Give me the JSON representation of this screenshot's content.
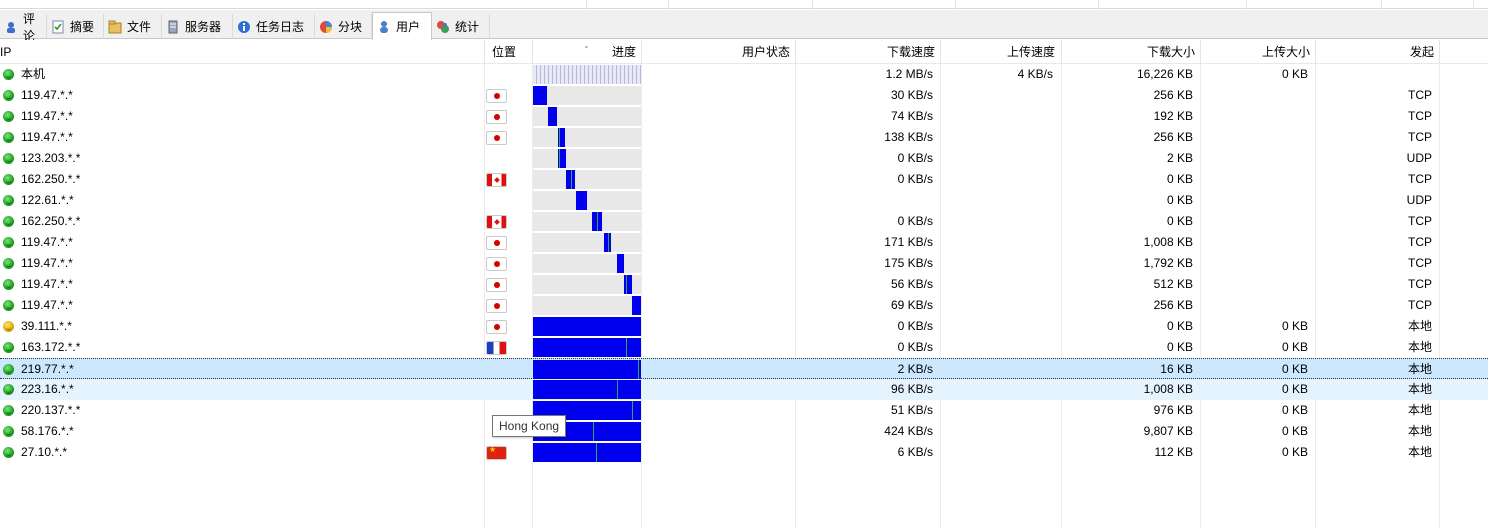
{
  "tabs": [
    {
      "label": "评论",
      "icon": "comment-icon"
    },
    {
      "label": "摘要",
      "icon": "summary-icon"
    },
    {
      "label": "文件",
      "icon": "files-icon"
    },
    {
      "label": "服务器",
      "icon": "server-icon"
    },
    {
      "label": "任务日志",
      "icon": "log-icon"
    },
    {
      "label": "分块",
      "icon": "pieces-icon"
    },
    {
      "label": "用户",
      "icon": "users-icon",
      "active": true
    },
    {
      "label": "统计",
      "icon": "stats-icon"
    }
  ],
  "columns": {
    "ip": "IP",
    "location": "位置",
    "progress": "进度",
    "user_status": "用户状态",
    "down_speed": "下载速度",
    "up_speed": "上传速度",
    "down_size": "下载大小",
    "up_size": "上传大小",
    "origin": "发起"
  },
  "peers": [
    {
      "ip": "本机",
      "status": "ok",
      "flag": "",
      "down_speed": "1.2 MB/s",
      "up_speed": "4 KB/s",
      "down_size": "16,226 KB",
      "up_size": "0 KB",
      "origin": "",
      "progress": {
        "local": true
      }
    },
    {
      "ip": "119.47.*.*",
      "status": "ok",
      "flag": "jp",
      "down_speed": "30 KB/s",
      "up_speed": "",
      "down_size": "256 KB",
      "up_size": "",
      "origin": "TCP",
      "progress": {
        "segments": [
          [
            0,
            14
          ]
        ],
        "marks": []
      }
    },
    {
      "ip": "119.47.*.*",
      "status": "ok",
      "flag": "jp",
      "down_speed": "74 KB/s",
      "up_speed": "",
      "down_size": "192 KB",
      "up_size": "",
      "origin": "TCP",
      "progress": {
        "segments": [
          [
            15,
            9
          ]
        ],
        "marks": []
      }
    },
    {
      "ip": "119.47.*.*",
      "status": "ok",
      "flag": "jp",
      "down_speed": "138 KB/s",
      "up_speed": "",
      "down_size": "256 KB",
      "up_size": "",
      "origin": "TCP",
      "progress": {
        "segments": [
          [
            25,
            7
          ]
        ],
        "marks": [
          26
        ]
      }
    },
    {
      "ip": "123.203.*.*",
      "status": "ok",
      "flag": "",
      "down_speed": "0 KB/s",
      "up_speed": "",
      "down_size": "2 KB",
      "up_size": "",
      "origin": "UDP",
      "progress": {
        "segments": [
          [
            25,
            8
          ]
        ],
        "marks": [
          26
        ]
      }
    },
    {
      "ip": "162.250.*.*",
      "status": "ok",
      "flag": "ca",
      "down_speed": "0 KB/s",
      "up_speed": "",
      "down_size": "0 KB",
      "up_size": "",
      "origin": "TCP",
      "progress": {
        "segments": [
          [
            33,
            9
          ]
        ],
        "marks": [
          38
        ]
      }
    },
    {
      "ip": "122.61.*.*",
      "status": "ok",
      "flag": "",
      "down_speed": "",
      "up_speed": "",
      "down_size": "0 KB",
      "up_size": "",
      "origin": "UDP",
      "progress": {
        "segments": [
          [
            43,
            11
          ]
        ],
        "marks": []
      }
    },
    {
      "ip": "162.250.*.*",
      "status": "ok",
      "flag": "ca",
      "down_speed": "0 KB/s",
      "up_speed": "",
      "down_size": "0 KB",
      "up_size": "",
      "origin": "TCP",
      "progress": {
        "segments": [
          [
            59,
            10
          ]
        ],
        "marks": [
          64
        ]
      }
    },
    {
      "ip": "119.47.*.*",
      "status": "ok",
      "flag": "jp",
      "down_speed": "171 KB/s",
      "up_speed": "",
      "down_size": "1,008 KB",
      "up_size": "",
      "origin": "TCP",
      "progress": {
        "segments": [
          [
            71,
            7
          ]
        ],
        "marks": [
          75
        ]
      }
    },
    {
      "ip": "119.47.*.*",
      "status": "ok",
      "flag": "jp",
      "down_speed": "175 KB/s",
      "up_speed": "",
      "down_size": "1,792 KB",
      "up_size": "",
      "origin": "TCP",
      "progress": {
        "segments": [
          [
            84,
            7
          ]
        ],
        "marks": []
      }
    },
    {
      "ip": "119.47.*.*",
      "status": "ok",
      "flag": "jp",
      "down_speed": "56 KB/s",
      "up_speed": "",
      "down_size": "512 KB",
      "up_size": "",
      "origin": "TCP",
      "progress": {
        "segments": [
          [
            91,
            8
          ]
        ],
        "marks": [
          93
        ]
      }
    },
    {
      "ip": "119.47.*.*",
      "status": "ok",
      "flag": "jp",
      "down_speed": "69 KB/s",
      "up_speed": "",
      "down_size": "256 KB",
      "up_size": "",
      "origin": "TCP",
      "progress": {
        "segments": [
          [
            99,
            9
          ]
        ],
        "marks": []
      }
    },
    {
      "ip": "39.111.*.*",
      "status": "warn",
      "flag": "jp",
      "down_speed": "0 KB/s",
      "up_speed": "",
      "down_size": "0 KB",
      "up_size": "0 KB",
      "origin": "本地",
      "progress": {
        "segments": [
          [
            0,
            108
          ]
        ],
        "marks": []
      }
    },
    {
      "ip": "163.172.*.*",
      "status": "ok",
      "flag": "fr",
      "down_speed": "0 KB/s",
      "up_speed": "",
      "down_size": "0 KB",
      "up_size": "0 KB",
      "origin": "本地",
      "progress": {
        "segments": [
          [
            0,
            108
          ]
        ],
        "marks": [
          93
        ]
      }
    },
    {
      "ip": "219.77.*.*",
      "status": "ok",
      "flag": "",
      "down_speed": "2 KB/s",
      "up_speed": "",
      "down_size": "16 KB",
      "up_size": "0 KB",
      "origin": "本地",
      "progress": {
        "segments": [
          [
            0,
            108
          ]
        ],
        "marks": [
          105
        ]
      },
      "selected": true
    },
    {
      "ip": "223.16.*.*",
      "status": "ok",
      "flag": "",
      "down_speed": "96 KB/s",
      "up_speed": "",
      "down_size": "1,008 KB",
      "up_size": "0 KB",
      "origin": "本地",
      "progress": {
        "segments": [
          [
            0,
            108
          ]
        ],
        "marks": [
          84
        ]
      },
      "hovered": true
    },
    {
      "ip": "220.137.*.*",
      "status": "ok",
      "flag": "",
      "down_speed": "51 KB/s",
      "up_speed": "",
      "down_size": "976 KB",
      "up_size": "0 KB",
      "origin": "本地",
      "progress": {
        "segments": [
          [
            0,
            108
          ]
        ],
        "marks": [
          99
        ]
      }
    },
    {
      "ip": "58.176.*.*",
      "status": "ok",
      "flag": "",
      "down_speed": "424 KB/s",
      "up_speed": "",
      "down_size": "9,807 KB",
      "up_size": "0 KB",
      "origin": "本地",
      "progress": {
        "segments": [
          [
            0,
            108
          ]
        ],
        "marks": [
          60
        ]
      }
    },
    {
      "ip": "27.10.*.*",
      "status": "ok",
      "flag": "cn",
      "down_speed": "6 KB/s",
      "up_speed": "",
      "down_size": "112 KB",
      "up_size": "0 KB",
      "origin": "本地",
      "progress": {
        "segments": [
          [
            0,
            108
          ]
        ],
        "marks": [
          63
        ]
      }
    }
  ],
  "tooltip": "Hong Kong",
  "colors": {
    "progress_fill": "#0000ee",
    "progress_bg": "#e8e8e8",
    "selected_row": "#cce8ff",
    "hover_row": "#e5f3ff"
  }
}
